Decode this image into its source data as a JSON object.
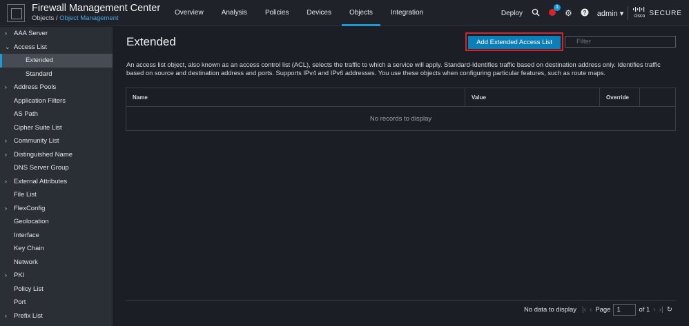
{
  "header": {
    "title": "Firewall Management Center",
    "breadcrumb_root": "Objects",
    "breadcrumb_sep": "/",
    "breadcrumb_current": "Object Management",
    "nav": [
      "Overview",
      "Analysis",
      "Policies",
      "Devices",
      "Objects",
      "Integration"
    ],
    "active_nav": "Objects",
    "deploy": "Deploy",
    "notification_count": "1",
    "user": "admin",
    "brand_small": "cisco",
    "brand": "SECURE"
  },
  "sidebar": {
    "items": [
      {
        "label": "AAA Server",
        "chevron": "›"
      },
      {
        "label": "Access List",
        "chevron": "⌄"
      },
      {
        "label": "Extended",
        "sub": true,
        "selected": true
      },
      {
        "label": "Standard",
        "sub": true
      },
      {
        "label": "Address Pools",
        "chevron": "›"
      },
      {
        "label": "Application Filters"
      },
      {
        "label": "AS Path"
      },
      {
        "label": "Cipher Suite List"
      },
      {
        "label": "Community List",
        "chevron": "›"
      },
      {
        "label": "Distinguished Name",
        "chevron": "›"
      },
      {
        "label": "DNS Server Group"
      },
      {
        "label": "External Attributes",
        "chevron": "›"
      },
      {
        "label": "File List"
      },
      {
        "label": "FlexConfig",
        "chevron": "›"
      },
      {
        "label": "Geolocation"
      },
      {
        "label": "Interface"
      },
      {
        "label": "Key Chain"
      },
      {
        "label": "Network"
      },
      {
        "label": "PKI",
        "chevron": "›"
      },
      {
        "label": "Policy List"
      },
      {
        "label": "Port"
      },
      {
        "label": "Prefix List",
        "chevron": "›"
      }
    ]
  },
  "main": {
    "title": "Extended",
    "add_button": "Add Extended Access List",
    "filter_placeholder": "Filter",
    "description": "An access list object, also known as an access control list (ACL), selects the traffic to which a service will apply. Standard-Identifies traffic based on destination address only. Identifies traffic based on source and destination address and ports. Supports IPv4 and IPv6 addresses. You use these objects when configuring particular features, such as route maps.",
    "columns": [
      "Name",
      "Value",
      "Override",
      ""
    ],
    "empty_message": "No records to display",
    "pager": {
      "status": "No data to display",
      "page_label": "Page",
      "page_value": "1",
      "of_label": "of 1"
    }
  },
  "colors": {
    "accent": "#1a9bd7",
    "button": "#0d7fb8",
    "highlight_box": "#d9222a",
    "alert": "#d9222a"
  }
}
